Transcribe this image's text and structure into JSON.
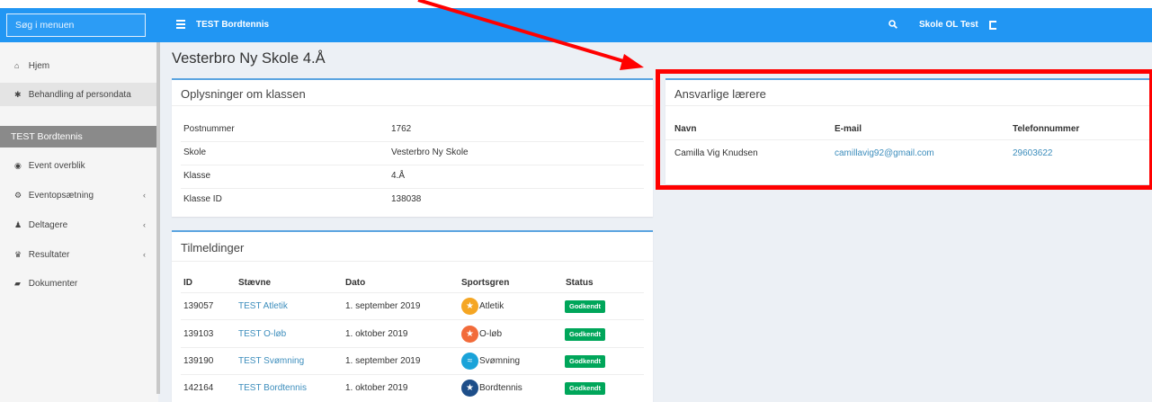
{
  "sidebar": {
    "search_placeholder": "Søg i menuen",
    "items_top": [
      {
        "icon": "home-icon",
        "glyph": "⌂",
        "label": "Hjem"
      },
      {
        "icon": "asterisk-icon",
        "glyph": "✱",
        "label": "Behandling af persondata"
      }
    ],
    "section_title": "TEST Bordtennis",
    "items": [
      {
        "icon": "dashboard-icon",
        "glyph": "◉",
        "label": "Event overblik",
        "chevron": ""
      },
      {
        "icon": "cogs-icon",
        "glyph": "⚙",
        "label": "Eventopsætning",
        "chevron": "‹"
      },
      {
        "icon": "users-icon",
        "glyph": "♟",
        "label": "Deltagere",
        "chevron": "‹"
      },
      {
        "icon": "trophy-icon",
        "glyph": "♛",
        "label": "Resultater",
        "chevron": "‹"
      },
      {
        "icon": "book-icon",
        "glyph": "▰",
        "label": "Dokumenter",
        "chevron": ""
      }
    ]
  },
  "header": {
    "title": "TEST Bordtennis",
    "user": "Skole OL Test"
  },
  "page": {
    "title": "Vesterbro Ny Skole 4.Å"
  },
  "class_info": {
    "title": "Oplysninger om klassen",
    "rows": [
      {
        "label": "Postnummer",
        "value": "1762"
      },
      {
        "label": "Skole",
        "value": "Vesterbro Ny Skole"
      },
      {
        "label": "Klasse",
        "value": "4.Å"
      },
      {
        "label": "Klasse ID",
        "value": "138038"
      }
    ]
  },
  "registrations": {
    "title": "Tilmeldinger",
    "headers": [
      "ID",
      "Stævne",
      "Dato",
      "Sportsgren",
      "Status"
    ],
    "rows": [
      {
        "id": "139057",
        "event": "TEST Atletik",
        "date": "1. september 2019",
        "sport": "Atletik",
        "sport_color": "#f5a623",
        "status": "Godkendt"
      },
      {
        "id": "139103",
        "event": "TEST O-løb",
        "date": "1. oktober 2019",
        "sport": "O-løb",
        "sport_color": "#f26b3a",
        "status": "Godkendt"
      },
      {
        "id": "139190",
        "event": "TEST Svømning",
        "date": "1. september 2019",
        "sport": "Svømning",
        "sport_color": "#1aa3d9",
        "status": "Godkendt"
      },
      {
        "id": "142164",
        "event": "TEST Bordtennis",
        "date": "1. oktober 2019",
        "sport": "Bordtennis",
        "sport_color": "#1d4e89",
        "status": "Godkendt"
      }
    ]
  },
  "teachers": {
    "title": "Ansvarlige lærere",
    "headers": [
      "Navn",
      "E-mail",
      "Telefonnummer"
    ],
    "rows": [
      {
        "name": "Camilla Vig Knudsen",
        "email": "camillavig92@gmail.com",
        "phone": "29603622"
      }
    ]
  },
  "colors": {
    "primary": "#2196f3",
    "box_border": "#5ba4e0",
    "success": "#00a65a",
    "link": "#3c8dbc",
    "highlight": "#ff0000"
  }
}
